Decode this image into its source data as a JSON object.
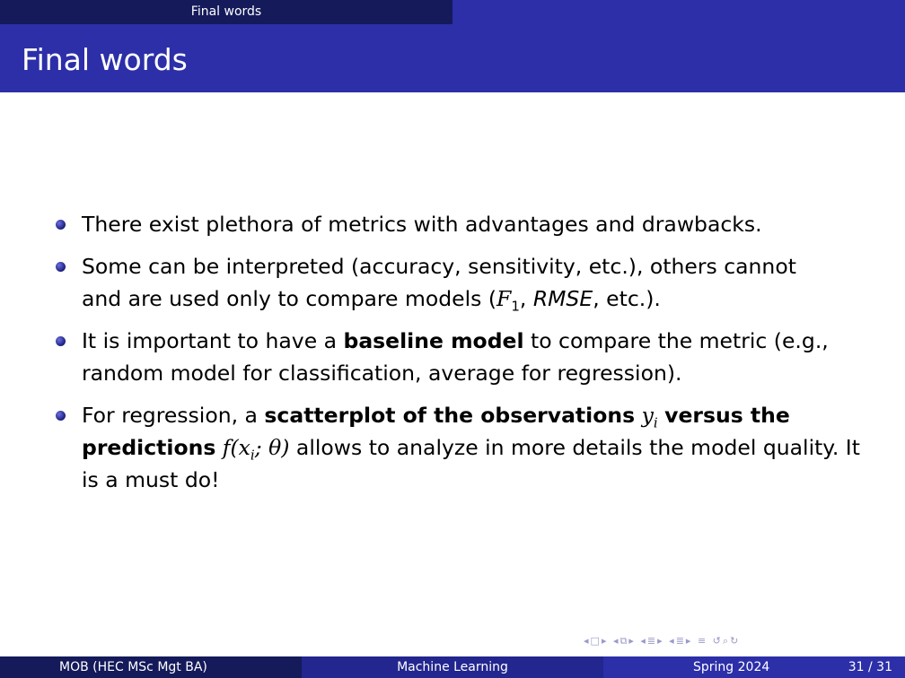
{
  "header": {
    "section": "Final words"
  },
  "slide": {
    "title": "Final words"
  },
  "bullets": [
    {
      "text": "There exist plethora of metrics with advantages and drawbacks."
    },
    {
      "line1": "Some can be interpreted (accuracy, sensitivity, etc.), others cannot",
      "line2_pre": "and are used only to compare models (",
      "f": "F",
      "f_sub": "1",
      "sep": ", ",
      "rmse": "RMSE",
      "line2_post": ", etc.)."
    },
    {
      "pre": "It is important to have a ",
      "bold": "baseline model",
      "post": " to compare the metric (e.g., random model for classification, average for regression)."
    },
    {
      "pre": "For regression, a ",
      "bold1": "scatterplot of the observations",
      "var_y": "y",
      "var_sub": "i",
      "bold2": "versus the predictions",
      "func": "f(x",
      "func_sub": "i",
      "func_end": "; θ)",
      "post": " allows to analyze in more details the model quality. It is a must do!"
    }
  ],
  "footer": {
    "author": "MOB  (HEC MSc Mgt BA)",
    "title": "Machine Learning",
    "date": "Spring 2024",
    "pages": "31 / 31"
  },
  "nav_icons": [
    "nav-prev-frame-icon",
    "nav-next-frame-icon",
    "nav-prev-subsection-icon",
    "nav-next-subsection-icon",
    "nav-prev-section-icon",
    "nav-next-section-icon",
    "nav-align-icon",
    "nav-search-icon"
  ]
}
